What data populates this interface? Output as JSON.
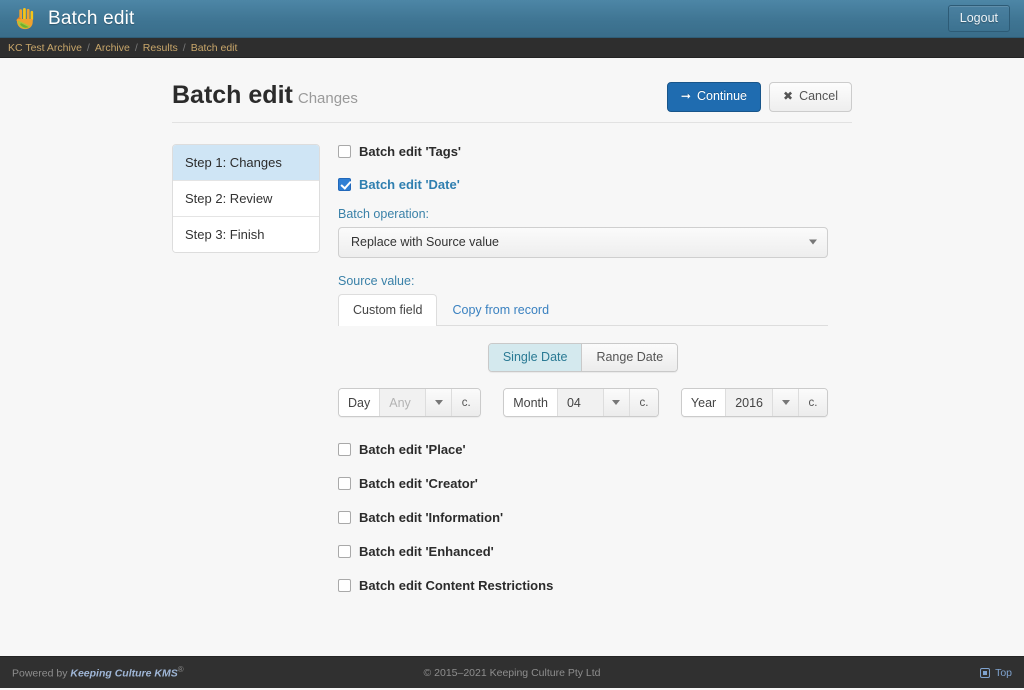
{
  "navbar": {
    "logo_icon": "hand-logo-icon",
    "title": "Batch edit",
    "logout_label": "Logout"
  },
  "breadcrumb": {
    "separator": "/",
    "items": [
      {
        "label": "KC Test Archive"
      },
      {
        "label": "Archive"
      },
      {
        "label": "Results"
      },
      {
        "label": "Batch edit"
      }
    ]
  },
  "header": {
    "title": "Batch edit",
    "subtitle": "Changes",
    "continue_label": "Continue",
    "continue_icon": "arrow-right-icon",
    "cancel_label": "Cancel",
    "cancel_icon": "close-x-icon"
  },
  "steps": [
    {
      "label": "Step 1: Changes",
      "active": true
    },
    {
      "label": "Step 2: Review",
      "active": false
    },
    {
      "label": "Step 3: Finish",
      "active": false
    }
  ],
  "form": {
    "tags_checkbox_label": "Batch edit 'Tags'",
    "date_checkbox_label": "Batch edit 'Date'",
    "batch_operation_label": "Batch operation:",
    "batch_operation_value": "Replace with Source value",
    "source_value_label": "Source value:",
    "tabs": [
      {
        "label": "Custom field",
        "active": true
      },
      {
        "label": "Copy from record",
        "active": false
      }
    ],
    "date_mode": [
      {
        "label": "Single Date",
        "active": true
      },
      {
        "label": "Range Date",
        "active": false
      }
    ],
    "date_fields": [
      {
        "addon": "Day",
        "value": "Any",
        "is_placeholder": true,
        "caret_icon": "chevron-down-icon",
        "clear_label": "c."
      },
      {
        "addon": "Month",
        "value": "04",
        "is_placeholder": false,
        "caret_icon": "chevron-down-icon",
        "clear_label": "c."
      },
      {
        "addon": "Year",
        "value": "2016",
        "is_placeholder": false,
        "caret_icon": "chevron-down-icon",
        "clear_label": "c."
      }
    ],
    "other_checkboxes": [
      {
        "label": "Batch edit 'Place'"
      },
      {
        "label": "Batch edit 'Creator'"
      },
      {
        "label": "Batch edit 'Information'"
      },
      {
        "label": "Batch edit 'Enhanced'"
      },
      {
        "label": "Batch edit Content Restrictions"
      }
    ]
  },
  "footer": {
    "powered_by": "Powered by",
    "product_name": "Keeping Culture KMS",
    "registered_mark": "®",
    "copyright": "© 2015–2021 Keeping Culture Pty Ltd",
    "top_label": "Top",
    "top_icon": "scroll-to-top-icon"
  },
  "colors": {
    "navbar_blue": "#3f7593",
    "breadcrumb_gold": "#c8a66a",
    "primary_blue": "#1f6cb0",
    "accent_link": "#3a81c0",
    "active_step_bg": "#cfe5f5",
    "segment_active_bg": "#d4e9ee",
    "footer_bg": "#303030"
  }
}
